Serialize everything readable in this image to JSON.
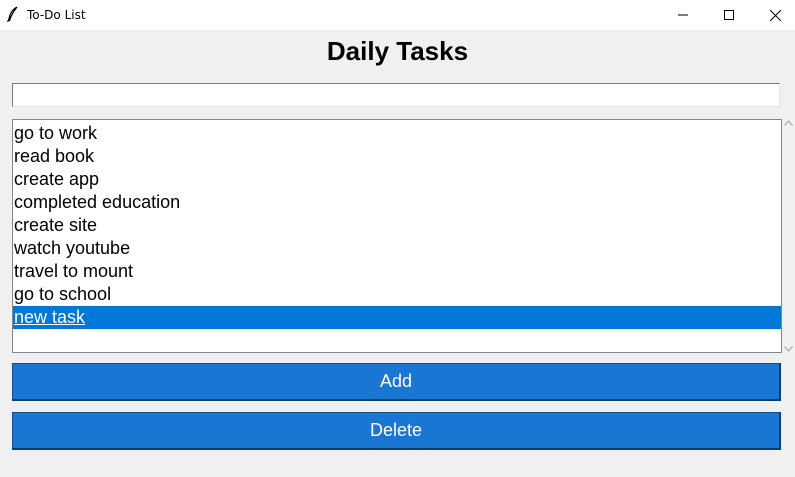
{
  "window": {
    "title": "To-Do List",
    "icon": "feather-icon",
    "controls": [
      "minimize-icon",
      "maximize-icon",
      "close-icon"
    ]
  },
  "heading": "Daily Tasks",
  "entry": {
    "value": ""
  },
  "tasks": [
    "go to work",
    "read book",
    "create app",
    "completed education",
    "create site",
    "watch youtube",
    "travel to mount",
    "go to school",
    "new task"
  ],
  "selected_task": "new task",
  "buttons": {
    "add": "Add",
    "delete": "Delete"
  },
  "colors": {
    "accent": "#1976d2",
    "selection": "#0078d7",
    "background": "#f0f0f0"
  }
}
